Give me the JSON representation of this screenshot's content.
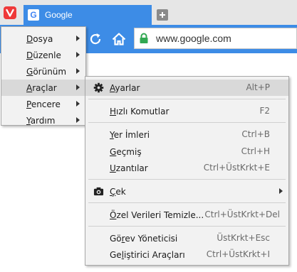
{
  "tab": {
    "title": "Google",
    "favicon_letter": "G"
  },
  "addressbar": {
    "url": "www.google.com"
  },
  "main_menu": {
    "items": [
      {
        "label": "Dosya",
        "mnemonic": "D",
        "rest": "osya"
      },
      {
        "label": "Düzenle",
        "mnemonic": "D",
        "rest": "üzenle"
      },
      {
        "label": "Görünüm",
        "mnemonic": "G",
        "rest": "örünüm"
      },
      {
        "label": "Araçlar",
        "mnemonic": "A",
        "rest": "raçlar"
      },
      {
        "label": "Pencere",
        "mnemonic": "P",
        "rest": "encere"
      },
      {
        "label": "Yardım",
        "mnemonic": "Y",
        "rest": "ardım"
      }
    ],
    "active": "Araçlar"
  },
  "tools_menu": {
    "settings": {
      "mnemonic": "A",
      "rest": "yarlar",
      "shortcut": "Alt+P"
    },
    "quick_commands": {
      "mnemonic": "H",
      "rest": "ızlı Komutlar",
      "shortcut": "F2"
    },
    "bookmarks": {
      "mnemonic": "Y",
      "rest": "er İmleri",
      "shortcut": "Ctrl+B"
    },
    "history": {
      "mnemonic": "G",
      "rest": "eçmiş",
      "shortcut": "Ctrl+H"
    },
    "extensions": {
      "mnemonic": "U",
      "rest": "zantılar",
      "shortcut": "Ctrl+ÜstKrkt+E"
    },
    "capture": {
      "mnemonic": "Ç",
      "rest": "ek"
    },
    "clear_private": {
      "mnemonic": "Ö",
      "rest": "zel Verileri Temizle...",
      "shortcut": "Ctrl+ÜstKrkt+Del"
    },
    "task_manager": {
      "prefix": "Gö",
      "mnemonic": "r",
      "rest": "ev Yöneticisi",
      "shortcut": "ÜstKrkt+Esc"
    },
    "dev_tools": {
      "prefix": "Ge",
      "mnemonic": "l",
      "rest": "iştirici Araçları",
      "shortcut": "Ctrl+ÜstKrkt+I"
    }
  },
  "colors": {
    "accent": "#3d8ce6",
    "vivaldi_red": "#ef3939",
    "menu_bg": "#f2f2f2",
    "highlight": "#d9d9d9"
  }
}
